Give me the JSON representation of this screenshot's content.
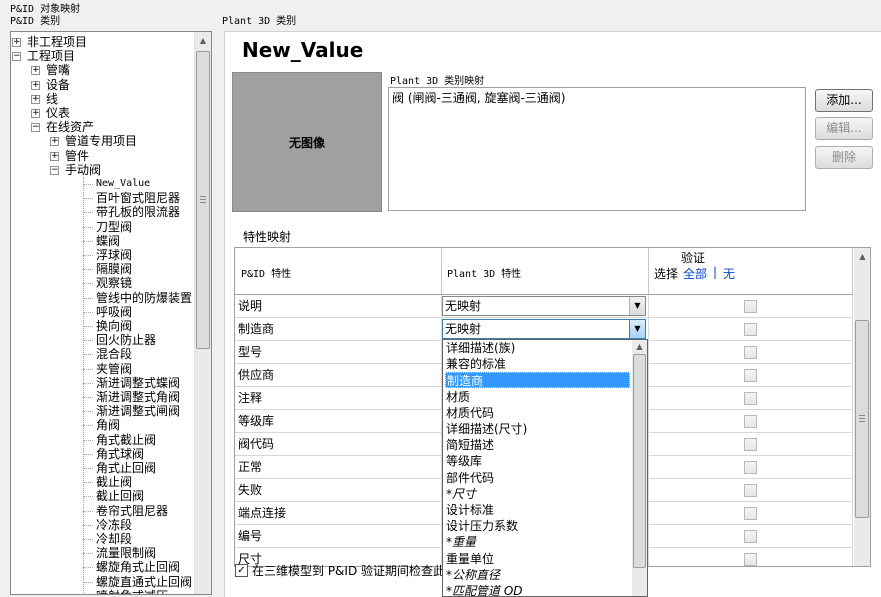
{
  "header": {
    "title": "P&ID 对象映射",
    "left_category_label": "P&ID 类别",
    "right_category_label": "Plant 3D 类别"
  },
  "tree": {
    "items": [
      {
        "label": "非工程项目",
        "level": 0,
        "toggle": "+"
      },
      {
        "label": "工程项目",
        "level": 0,
        "toggle": "-"
      },
      {
        "label": "管嘴",
        "level": 1,
        "toggle": "+"
      },
      {
        "label": "设备",
        "level": 1,
        "toggle": "+"
      },
      {
        "label": "线",
        "level": 1,
        "toggle": "+"
      },
      {
        "label": "仪表",
        "level": 1,
        "toggle": "+"
      },
      {
        "label": "在线资产",
        "level": 1,
        "toggle": "-"
      },
      {
        "label": "管道专用项目",
        "level": 2,
        "toggle": "+"
      },
      {
        "label": "管件",
        "level": 2,
        "toggle": "+"
      },
      {
        "label": "手动阀",
        "level": 2,
        "toggle": "-"
      },
      {
        "label": "New_Value",
        "level": 3,
        "mono": true
      },
      {
        "label": "百叶窗式阻尼器",
        "level": 3
      },
      {
        "label": "带孔板的限流器",
        "level": 3
      },
      {
        "label": "刀型阀",
        "level": 3
      },
      {
        "label": "蝶阀",
        "level": 3
      },
      {
        "label": "浮球阀",
        "level": 3
      },
      {
        "label": "隔膜阀",
        "level": 3
      },
      {
        "label": "观察镜",
        "level": 3
      },
      {
        "label": "管线中的防爆装置",
        "level": 3
      },
      {
        "label": "呼吸阀",
        "level": 3
      },
      {
        "label": "换向阀",
        "level": 3
      },
      {
        "label": "回火防止器",
        "level": 3
      },
      {
        "label": "混合段",
        "level": 3
      },
      {
        "label": "夹管阀",
        "level": 3
      },
      {
        "label": "渐进调整式蝶阀",
        "level": 3
      },
      {
        "label": "渐进调整式角阀",
        "level": 3
      },
      {
        "label": "渐进调整式闸阀",
        "level": 3
      },
      {
        "label": "角阀",
        "level": 3
      },
      {
        "label": "角式截止阀",
        "level": 3
      },
      {
        "label": "角式球阀",
        "level": 3
      },
      {
        "label": "角式止回阀",
        "level": 3
      },
      {
        "label": "截止阀",
        "level": 3
      },
      {
        "label": "截止回阀",
        "level": 3
      },
      {
        "label": "卷帘式阻尼器",
        "level": 3
      },
      {
        "label": "冷冻段",
        "level": 3
      },
      {
        "label": "冷却段",
        "level": 3
      },
      {
        "label": "流量限制阀",
        "level": 3
      },
      {
        "label": "螺旋角式止回阀",
        "level": 3
      },
      {
        "label": "螺旋直通式止回阀",
        "level": 3
      },
      {
        "label": "喷射角式减压",
        "level": 3
      }
    ]
  },
  "detail": {
    "name": "New_Value",
    "no_image_label": "无图像",
    "class_mapping_label": "Plant 3D 类别映射",
    "class_mapping_value": "阀 (闸阀-三通阀, 旋塞阀-三通阀)",
    "buttons": {
      "add": "添加...",
      "edit": "编辑...",
      "delete": "删除"
    }
  },
  "properties": {
    "section_label": "特性映射",
    "headers": {
      "pid": "P&ID 特性",
      "plant3d": "Plant 3D 特性",
      "verify": "验证",
      "select": "选择",
      "select_all": "全部",
      "separator": "|",
      "select_none": "无"
    },
    "rows": [
      {
        "pid": "说明",
        "plant3d": "无映射",
        "combo": true
      },
      {
        "pid": "制造商",
        "plant3d": "无映射",
        "combo": true,
        "open": true
      },
      {
        "pid": "型号",
        "plant3d": ""
      },
      {
        "pid": "供应商",
        "plant3d": ""
      },
      {
        "pid": "注释",
        "plant3d": ""
      },
      {
        "pid": "等级库",
        "plant3d": ""
      },
      {
        "pid": "阀代码",
        "plant3d": ""
      },
      {
        "pid": "正常",
        "plant3d": ""
      },
      {
        "pid": "失败",
        "plant3d": ""
      },
      {
        "pid": "端点连接",
        "plant3d": ""
      },
      {
        "pid": "编号",
        "plant3d": ""
      },
      {
        "pid": "尺寸",
        "plant3d": ""
      }
    ],
    "dropdown_options": [
      {
        "label": "详细描述(族)"
      },
      {
        "label": "兼容的标准"
      },
      {
        "label": "制造商",
        "selected": true
      },
      {
        "label": "材质"
      },
      {
        "label": "材质代码"
      },
      {
        "label": "详细描述(尺寸)"
      },
      {
        "label": "简短描述"
      },
      {
        "label": "等级库"
      },
      {
        "label": "部件代码"
      },
      {
        "label": "*尺寸",
        "italic": true
      },
      {
        "label": "设计标准"
      },
      {
        "label": "设计压力系数"
      },
      {
        "label": "*重量",
        "italic": true
      },
      {
        "label": "重量单位"
      },
      {
        "label": "*公称直径",
        "italic": true
      },
      {
        "label": "*匹配管道 OD",
        "italic": true
      }
    ]
  },
  "footer": {
    "check_label": "在三维模型到 P&ID 验证期间检查此",
    "checked": true
  }
}
